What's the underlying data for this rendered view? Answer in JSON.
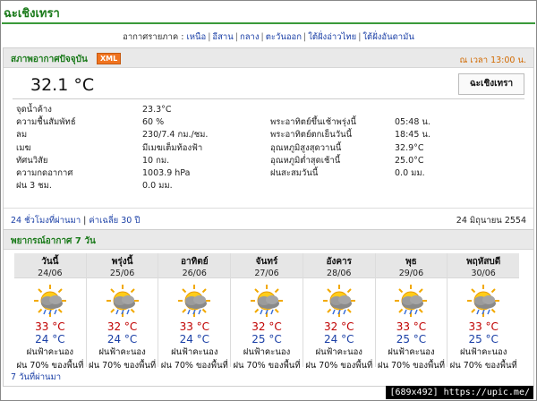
{
  "page": {
    "title": "ฉะเชิงเทรา"
  },
  "region_nav": {
    "prefix": "อากาศรายภาค :",
    "links": [
      "เหนือ",
      "อีสาน",
      "กลาง",
      "ตะวันออก",
      "ใต้ฝั่งอ่าวไทย",
      "ใต้ฝั่งอันดามัน"
    ]
  },
  "current": {
    "header": "สภาพอากาศปัจจุบัน",
    "xml_badge": "XML",
    "as_of": "ณ เวลา 13:00 น.",
    "temperature": "32.1 °C",
    "station": "ฉะเชิงเทรา",
    "left": [
      {
        "label": "จุดน้ำค้าง",
        "value": "23.3°C"
      },
      {
        "label": "ความชื้นสัมพัทธ์",
        "value": "60 %"
      },
      {
        "label": "ลม",
        "value": "230/7.4 กม./ชม."
      },
      {
        "label": "เมฆ",
        "value": "มีเมฆเต็มท้องฟ้า"
      },
      {
        "label": "ทัศนวิสัย",
        "value": "10 กม."
      },
      {
        "label": "ความกดอากาศ",
        "value": "1003.9 hPa"
      },
      {
        "label": "ฝน 3 ชม.",
        "value": "0.0 มม."
      }
    ],
    "right": [
      {
        "label": "",
        "value": ""
      },
      {
        "label": "พระอาทิตย์ขึ้นเช้าพรุ่งนี้",
        "value": "05:48 น."
      },
      {
        "label": "พระอาทิตย์ตกเย็นวันนี้",
        "value": "18:45 น."
      },
      {
        "label": "อุณหภูมิสูงสุดวานนี้",
        "value": "32.9°C"
      },
      {
        "label": "อุณหภูมิต่ำสุดเช้านี้",
        "value": "25.0°C"
      },
      {
        "label": "ฝนสะสมวันนี้",
        "value": "0.0 มม."
      }
    ],
    "footer": {
      "link_24h": "24 ชั่วโมงที่ผ่านมา",
      "link_30y": "ค่าเฉลี่ย 30 ปี",
      "date": "24 มิถุนายน 2554"
    }
  },
  "forecast": {
    "header": "พยากรณ์อากาศ 7 วัน",
    "days": [
      {
        "name": "วันนี้",
        "date": "24/06",
        "max": "33 °C",
        "min": "24 °C",
        "desc": "ฝนฟ้าคะนอง",
        "rain": "ฝน 70% ของพื้นที่",
        "icon": "sun-cloud-rain-icon"
      },
      {
        "name": "พรุ่งนี้",
        "date": "25/06",
        "max": "32 °C",
        "min": "24 °C",
        "desc": "ฝนฟ้าคะนอง",
        "rain": "ฝน 70% ของพื้นที่",
        "icon": "sun-cloud-rain-icon"
      },
      {
        "name": "อาทิตย์",
        "date": "26/06",
        "max": "33 °C",
        "min": "24 °C",
        "desc": "ฝนฟ้าคะนอง",
        "rain": "ฝน 70% ของพื้นที่",
        "icon": "sun-cloud-rain-icon"
      },
      {
        "name": "จันทร์",
        "date": "27/06",
        "max": "32 °C",
        "min": "25 °C",
        "desc": "ฝนฟ้าคะนอง",
        "rain": "ฝน 70% ของพื้นที่",
        "icon": "sun-cloud-rain-icon"
      },
      {
        "name": "อังคาร",
        "date": "28/06",
        "max": "32 °C",
        "min": "24 °C",
        "desc": "ฝนฟ้าคะนอง",
        "rain": "ฝน 70% ของพื้นที่",
        "icon": "sun-cloud-rain-icon"
      },
      {
        "name": "พุธ",
        "date": "29/06",
        "max": "33 °C",
        "min": "25 °C",
        "desc": "ฝนฟ้าคะนอง",
        "rain": "ฝน 70% ของพื้นที่",
        "icon": "sun-cloud-rain-icon"
      },
      {
        "name": "พฤหัสบดี",
        "date": "30/06",
        "max": "33 °C",
        "min": "25 °C",
        "desc": "ฝนฟ้าคะนอง",
        "rain": "ฝน 70% ของพื้นที่",
        "icon": "sun-cloud-rain-icon"
      }
    ],
    "footer_link": "7 วันที่ผ่านมา"
  },
  "watermark": "[689x492] https://upic.me/",
  "colors": {
    "title_green": "#1a7a1a",
    "max_red": "#c00000",
    "min_blue": "#1a3fa6",
    "xml_orange": "#f0731f",
    "time_orange": "#d26a00"
  }
}
